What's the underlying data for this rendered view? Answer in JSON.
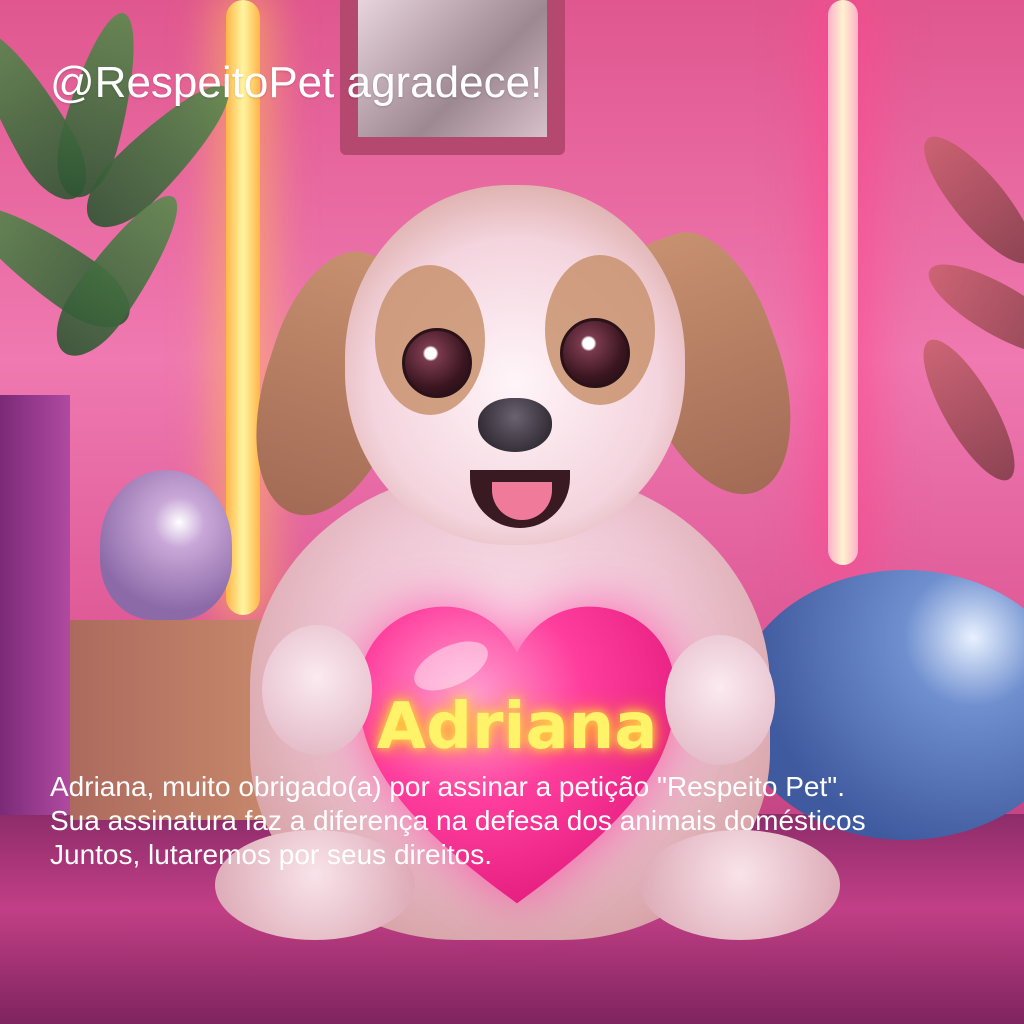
{
  "header": {
    "title": "@RespeitoPet agradece!"
  },
  "heart": {
    "name": "Adriana"
  },
  "message": {
    "lines": [
      "Adriana, muito obrigado(a) por assinar a petição \"Respeito Pet\".",
      "Sua assinatura faz a diferença na defesa dos animais domésticos",
      "Juntos, lutaremos por seus direitos."
    ]
  },
  "colors": {
    "heart": "#ff3d9c",
    "heart_text": "#fff36a",
    "overlay_text": "#ffffff",
    "background": "#ef79b0"
  },
  "icons": {
    "heart": "heart-icon"
  }
}
